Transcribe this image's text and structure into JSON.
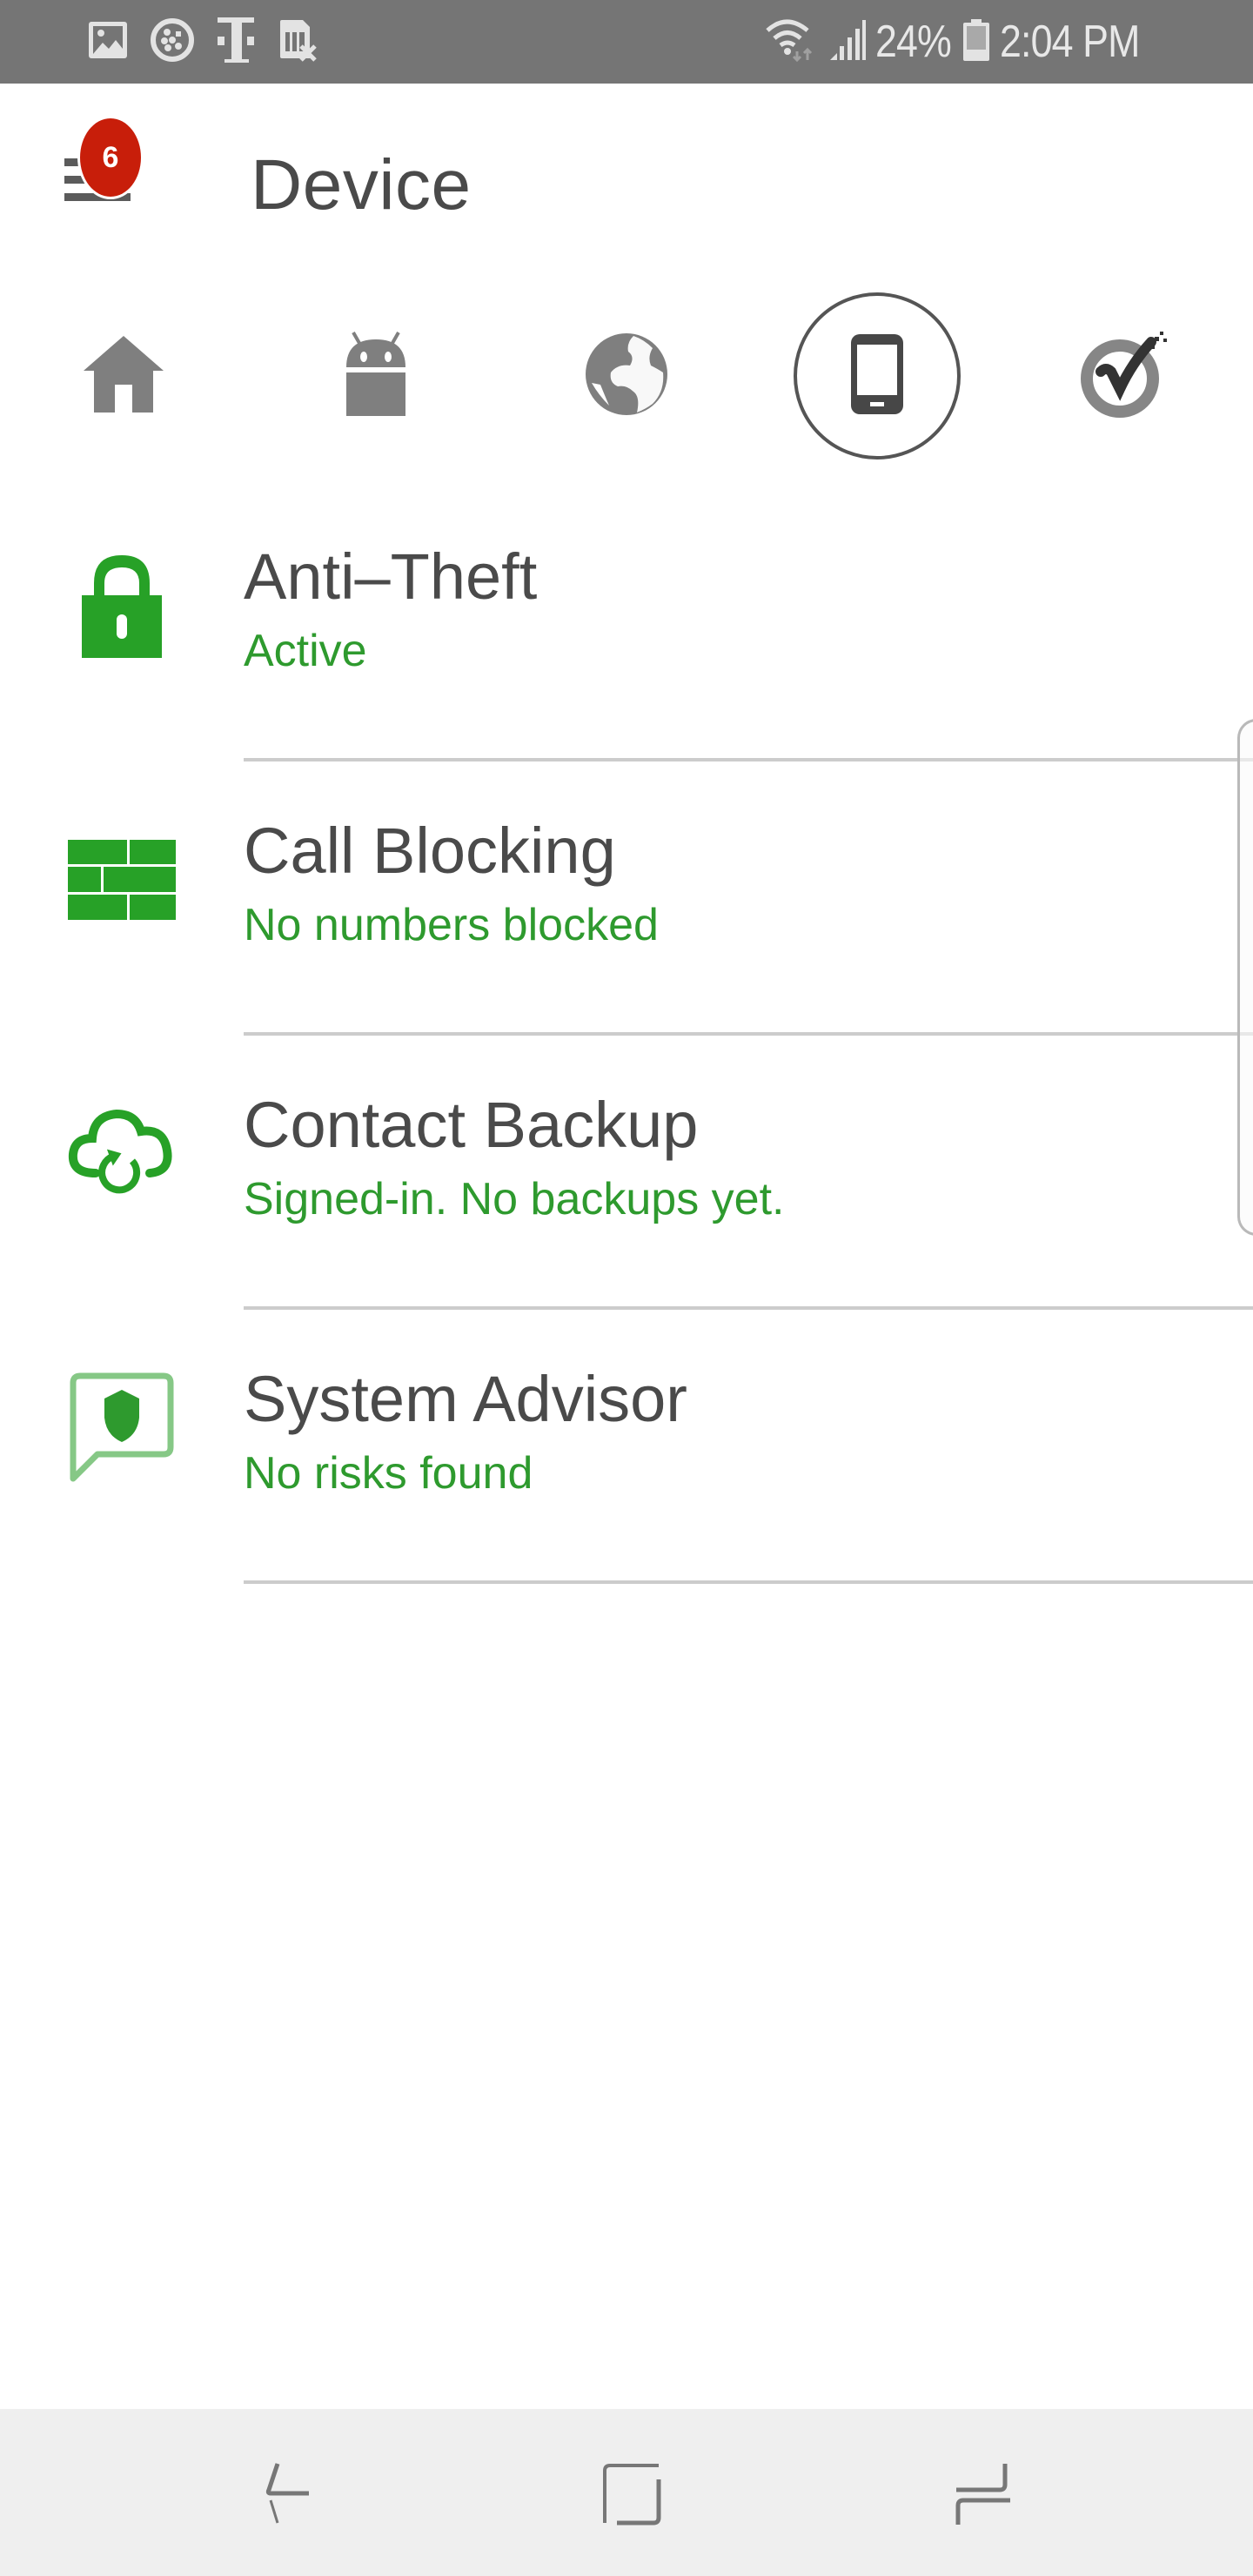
{
  "status_bar": {
    "left_icons": [
      "gallery-icon",
      "app-lock-icon",
      "t-mobile-icon",
      "no-sim-icon"
    ],
    "right_icons": [
      "wifi-data-icon",
      "signal-icon",
      "battery-icon"
    ],
    "battery_percent": "24%",
    "battery_level": 0.24,
    "time": "2:04 PM"
  },
  "header": {
    "menu_icon": "hamburger-menu-icon",
    "notification_count": "6",
    "title": "Device",
    "badge_color": "#c81e0a"
  },
  "tabs": [
    {
      "name": "home",
      "icon": "home-icon",
      "selected": false
    },
    {
      "name": "android",
      "icon": "android-icon",
      "selected": false
    },
    {
      "name": "web",
      "icon": "globe-icon",
      "selected": false
    },
    {
      "name": "device",
      "icon": "phone-icon",
      "selected": true
    },
    {
      "name": "norton",
      "icon": "norton-check-icon",
      "selected": false
    }
  ],
  "features": [
    {
      "title": "Anti–Theft",
      "status": "Active",
      "icon": "lock-icon"
    },
    {
      "title": "Call Blocking",
      "status": "No numbers blocked",
      "icon": "brick-wall-icon"
    },
    {
      "title": "Contact Backup",
      "status": "Signed-in. No backups yet.",
      "icon": "cloud-sync-icon"
    },
    {
      "title": "System Advisor",
      "status": "No risks found",
      "icon": "shield-chat-icon"
    }
  ],
  "colors": {
    "accent_green": "#2e9a2e",
    "icon_green": "#27a127",
    "status_bar_bg": "#757575",
    "nav_bar_bg": "#efefef",
    "divider": "#cccccc"
  },
  "nav_bar": {
    "buttons": [
      "back-icon",
      "home-square-icon",
      "recents-icon"
    ]
  }
}
